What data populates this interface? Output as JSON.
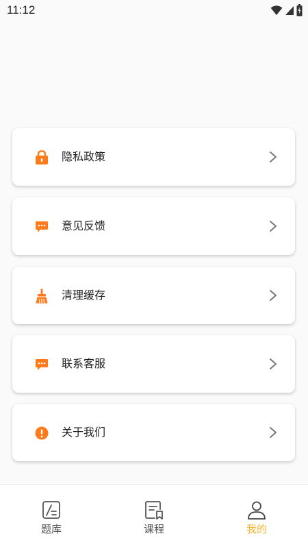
{
  "status_bar": {
    "time": "11:12",
    "icons": [
      "wifi-icon",
      "signal-icon",
      "battery-icon"
    ]
  },
  "menu": [
    {
      "label": "隐私政策",
      "icon": "lock-icon"
    },
    {
      "label": "意见反馈",
      "icon": "message-icon"
    },
    {
      "label": "清理缓存",
      "icon": "broom-icon"
    },
    {
      "label": "联系客服",
      "icon": "chat-icon"
    },
    {
      "label": "关于我们",
      "icon": "info-icon"
    }
  ],
  "tabs": [
    {
      "label": "题库",
      "icon": "question-bank-icon",
      "active": false
    },
    {
      "label": "课程",
      "icon": "course-icon",
      "active": false
    },
    {
      "label": "我的",
      "icon": "profile-icon",
      "active": true
    }
  ],
  "colors": {
    "accent": "#ff7a1a",
    "tab_active": "#f5b32e",
    "tab_inactive": "#555555"
  }
}
